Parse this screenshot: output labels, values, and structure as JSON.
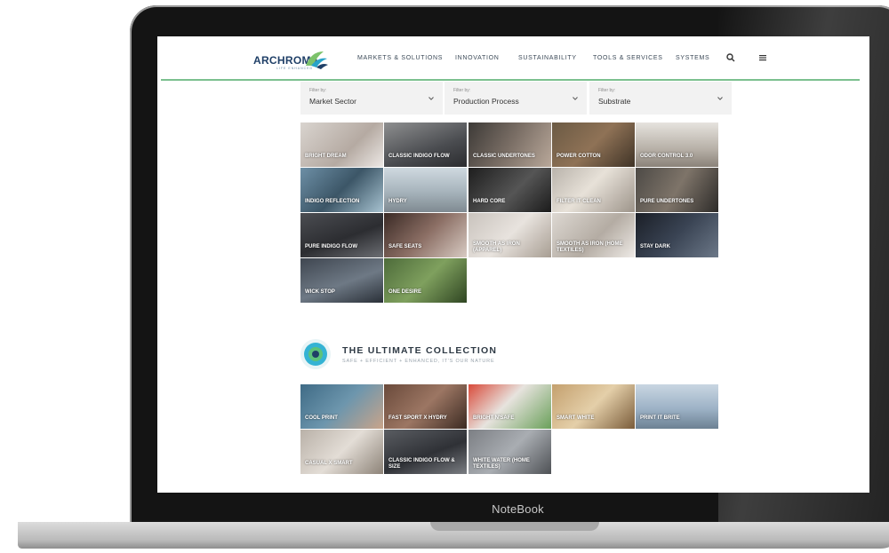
{
  "device": {
    "brand_label": "NoteBook"
  },
  "logo": {
    "text": "ARCHROMA",
    "subtext": "LIFE ENHANCED"
  },
  "nav": {
    "items": [
      "MARKETS & SOLUTIONS",
      "INNOVATION",
      "SUSTAINABILITY",
      "TOOLS & SERVICES",
      "SYSTEMS"
    ],
    "search_icon": "search-icon",
    "menu_icon": "hamburger-menu-icon"
  },
  "filters": [
    {
      "label": "Filter by:",
      "value": "Market Sector"
    },
    {
      "label": "Filter by:",
      "value": "Production Process"
    },
    {
      "label": "Filter by:",
      "value": "Substrate"
    }
  ],
  "tiles": [
    "BRIGHT DREAM",
    "CLASSIC INDIGO FLOW",
    "CLASSIC UNDERTONES",
    "POWER COTTON",
    "ODOR CONTROL 3.0",
    "INDIGO REFLECTION",
    "HYDRY",
    "HARD CORE",
    "FILTER IT CLEAN",
    "PURE UNDERTONES",
    "PURE INDIGO FLOW",
    "SAFE SEATS",
    "SMOOTH AS IRON (APPAREL)",
    "SMOOTH AS IRON (HOME TEXTILES)",
    "STAY DARK",
    "WICK STOP",
    "ONE DESIRE"
  ],
  "collection": {
    "title": "THE ULTIMATE COLLECTION",
    "subtitle": "SAFE + EFFICIENT + ENHANCED, IT'S OUR NATURE",
    "tiles": [
      "COOL PRINT",
      "FAST SPORT X HYDRY",
      "BRIGHT N'SAFE",
      "SMART WHITE",
      "PRINT IT BRITE",
      "CASUAL X SMART",
      "CLASSIC INDIGO FLOW & SIZE",
      "WHITE WATER (HOME TEXTILES)"
    ]
  },
  "colors": {
    "accent_green": "#7cc08f",
    "logo_blue": "#1f3f67"
  }
}
